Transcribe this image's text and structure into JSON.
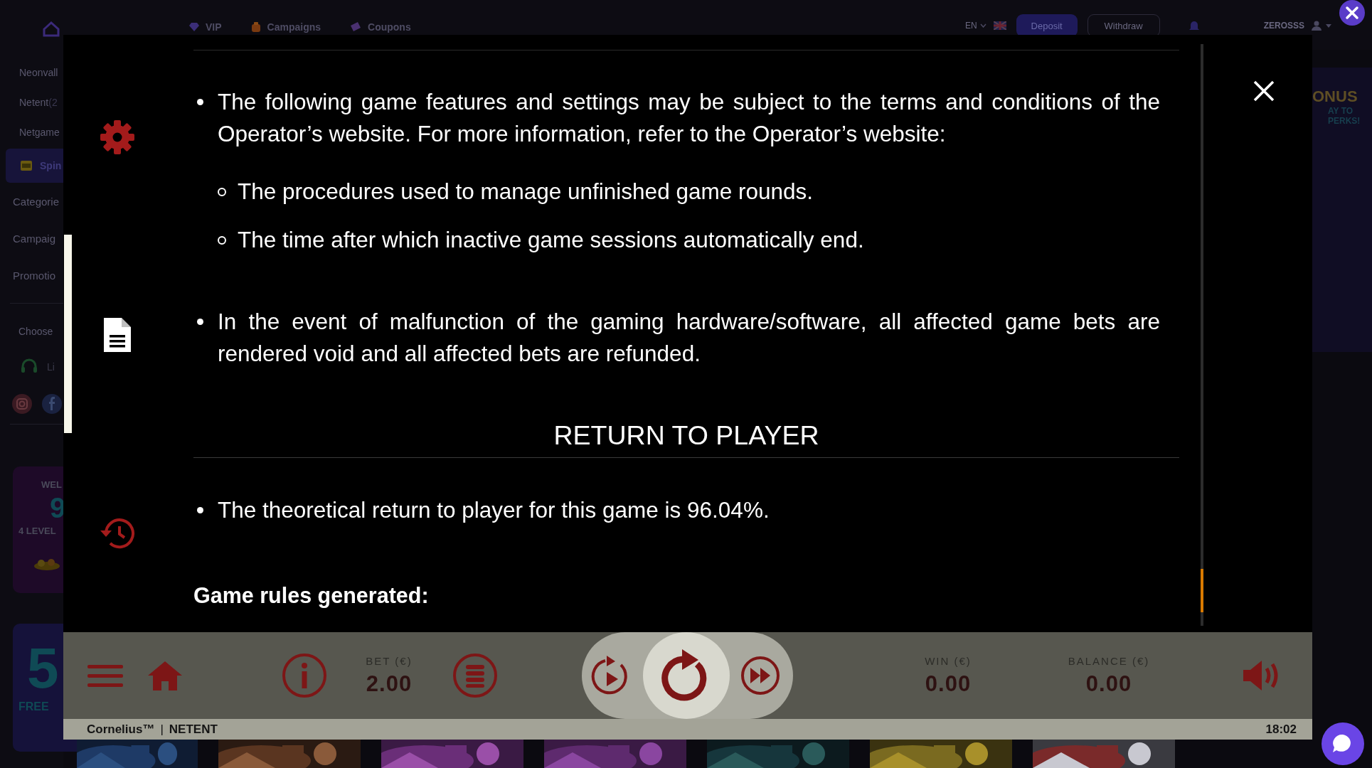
{
  "site_header": {
    "nav": [
      {
        "label": "VIP"
      },
      {
        "label": "Campaigns"
      },
      {
        "label": "Coupons"
      }
    ],
    "language": "EN",
    "buttons": [
      "Deposit",
      "Withdraw"
    ],
    "username": "ZEROSSS"
  },
  "sidebar": {
    "items": [
      {
        "label": "Neonvall",
        "kind": "provider"
      },
      {
        "label": "Netent",
        "suffix": "(2",
        "kind": "provider"
      },
      {
        "label": "Netgame",
        "kind": "provider"
      },
      {
        "label": "Spin",
        "kind": "featured"
      },
      {
        "label": "Categorie",
        "kind": "section"
      },
      {
        "label": "Campaig",
        "kind": "section"
      },
      {
        "label": "Promotio",
        "kind": "section"
      }
    ],
    "choose": "Choose",
    "live": "Li",
    "promo_cards": [
      {
        "top": "WEL",
        "big": "9",
        "bottom": "4 LEVEL"
      },
      {
        "big": "5",
        "bottom": "FREE"
      }
    ]
  },
  "right_banner": {
    "title": "ONUS",
    "lines": [
      "AY TO",
      "PERKS!"
    ]
  },
  "rules_modal": {
    "sections": [
      {
        "selected": false,
        "blocks": [
          {
            "kind": "bullet",
            "text": "The following game features and settings may be subject to the terms and conditions of the Operator’s website. For more information, refer to the Operator’s website:",
            "children": [
              {
                "text": "The procedures used to manage unfinished game rounds."
              },
              {
                "text": "The time after which inactive game sessions automatically end."
              }
            ]
          }
        ]
      },
      {
        "selected": true,
        "blocks": [
          {
            "kind": "bullet",
            "text": "In the event of malfunction of the gaming hardware/software, all affected game bets are rendered void and all affected bets are refunded."
          }
        ]
      },
      {
        "selected": false,
        "blocks": [
          {
            "kind": "heading",
            "text": "RETURN TO PLAYER"
          },
          {
            "kind": "bullet",
            "text": "The theoretical return to player for this game is 96.04%."
          },
          {
            "kind": "note",
            "text": "Game rules generated:"
          }
        ]
      }
    ]
  },
  "game_bar": {
    "bet_label": "BET (€)",
    "bet": "2.00",
    "win_label": "WIN (€)",
    "win": "0.00",
    "balance_label": "BALANCE (€)",
    "balance": "0.00"
  },
  "status_bar": {
    "game": "Cornelius™",
    "separator": "|",
    "provider": "NETENT",
    "time": "18:02"
  }
}
